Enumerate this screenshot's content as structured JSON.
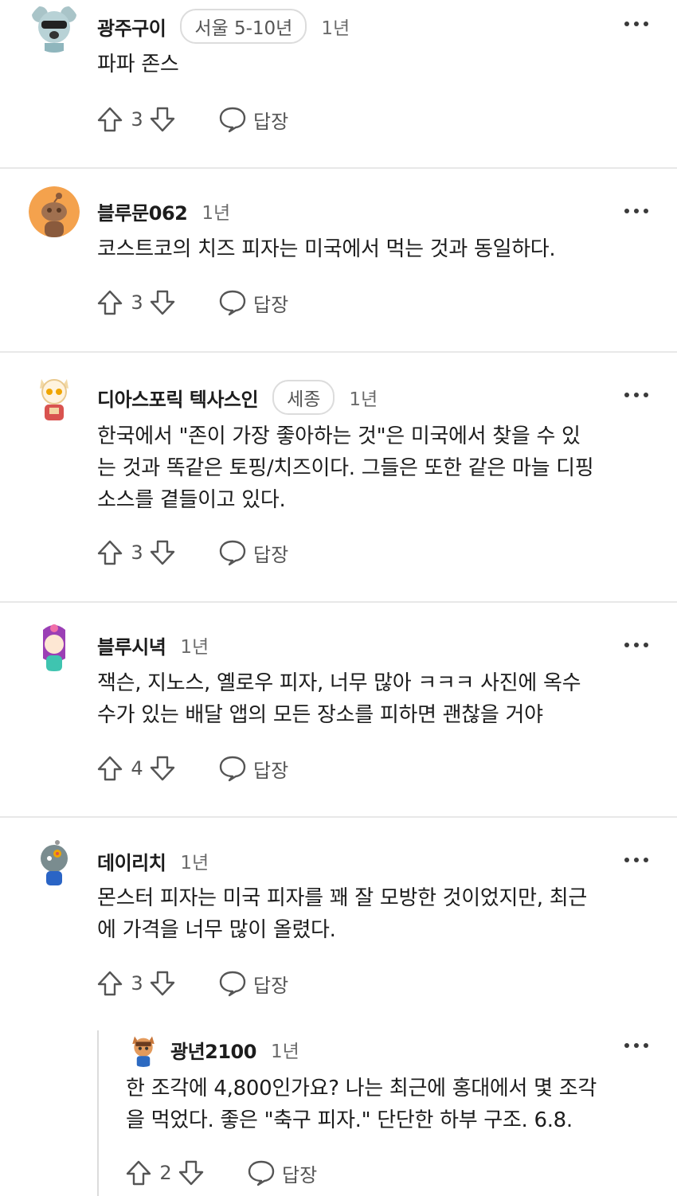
{
  "labels": {
    "reply": "답장"
  },
  "comments": [
    {
      "username": "광주구이",
      "flair": "서울 5-10년",
      "age": "1년",
      "lines": [
        "파파 존스"
      ],
      "score": "3"
    },
    {
      "username": "블루문062",
      "flair": "",
      "age": "1년",
      "lines": [
        "코스트코의 치즈 피자는 미국에서 먹는 것과 동일하다."
      ],
      "score": "3"
    },
    {
      "username": "디아스포릭 텍사스인",
      "flair": "세종",
      "age": "1년",
      "lines": [
        "한국에서 \"존이 가장 좋아하는 것\"은 미국에서 찾을 수 있",
        "는 것과 똑같은 토핑/치즈이다. 그들은 또한 같은 마늘 디핑",
        "소스를 곁들이고 있다."
      ],
      "score": "3"
    },
    {
      "username": "블루시녁",
      "flair": "",
      "age": "1년",
      "lines": [
        "잭슨, 지노스, 옐로우 피자, 너무 많아 ㅋㅋㅋ 사진에 옥수",
        "수가 있는 배달 앱의 모든 장소를 피하면 괜찮을 거야"
      ],
      "score": "4"
    },
    {
      "username": "데이리치",
      "flair": "",
      "age": "1년",
      "lines": [
        "몬스터 피자는 미국 피자를 꽤 잘 모방한 것이었지만, 최근",
        "에 가격을 너무 많이 올렸다."
      ],
      "score": "3"
    },
    {
      "username": "광년2100",
      "flair": "",
      "age": "1년",
      "lines": [
        "한 조각에 4,800인가요? 나는 최근에 홍대에서 몇 조각",
        "을 먹었다. 좋은 \"축구 피자.\" 단단한 하부 구조. 6.8."
      ],
      "score": "2"
    }
  ]
}
